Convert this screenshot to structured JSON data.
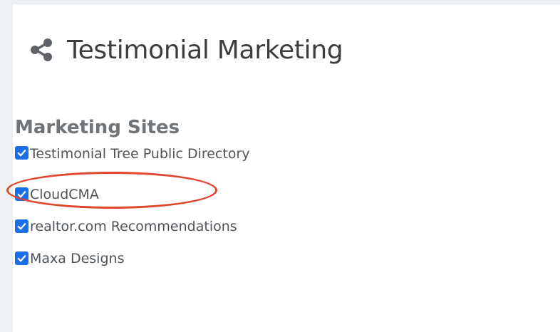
{
  "header": {
    "title": "Testimonial Marketing",
    "icon": "share-icon"
  },
  "marketing_sites": {
    "heading": "Marketing Sites",
    "items": [
      {
        "label": "Testimonial Tree Public Directory",
        "checked": true
      },
      {
        "label": "CloudCMA",
        "checked": true
      },
      {
        "label": "realtor.com Recommendations",
        "checked": true
      },
      {
        "label": "Maxa Designs",
        "checked": true
      }
    ]
  },
  "colors": {
    "checkbox": "#1a6fe8",
    "annotation_ring": "#e0462c",
    "title": "#3a3d40",
    "heading": "#6f7478"
  }
}
